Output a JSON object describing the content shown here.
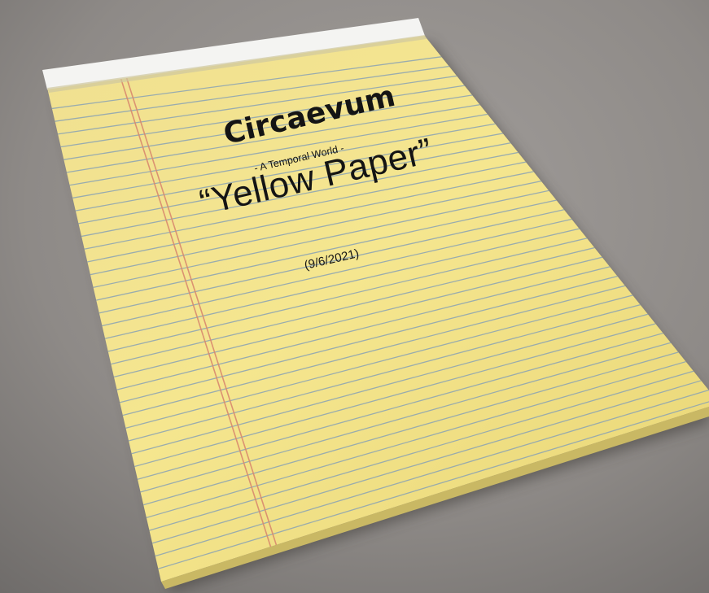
{
  "scene": {
    "subject": "yellow-legal-pad",
    "colors": {
      "desk": "#8f8b88",
      "paper": "#f3e38a",
      "paper_edge": "#e7d472",
      "binding": "#f4f4f2",
      "rule_line": "#8aa3b4",
      "margin_line": "#d98a6e"
    }
  },
  "pad_text": {
    "title": "Circaevum",
    "subtitle": "- A Temporal World -",
    "quote": "“Yellow Paper”",
    "date": "(9/6/2021)"
  }
}
